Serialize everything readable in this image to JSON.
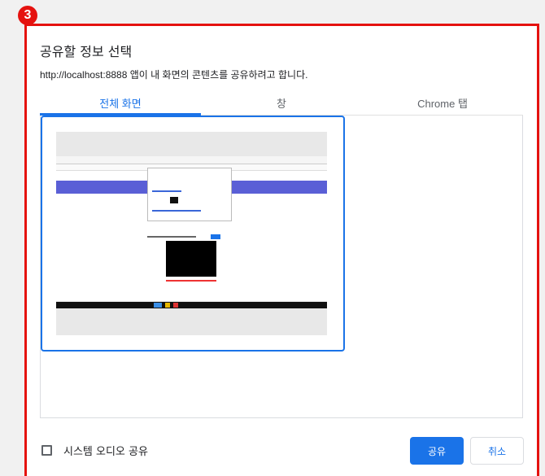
{
  "step_badge": "3",
  "dialog": {
    "title": "공유할 정보 선택",
    "subtitle": "http://localhost:8888 앱이 내 화면의 콘텐츠를 공유하려고 합니다.",
    "tabs": [
      {
        "label": "전체 화면",
        "active": true
      },
      {
        "label": "창",
        "active": false
      },
      {
        "label": "Chrome 탭",
        "active": false
      }
    ],
    "audio_checkbox_label": "시스템 오디오 공유",
    "audio_checked": false,
    "share_button": "공유",
    "cancel_button": "취소"
  },
  "colors": {
    "accent": "#1a73e8",
    "highlight": "#e5120f"
  }
}
